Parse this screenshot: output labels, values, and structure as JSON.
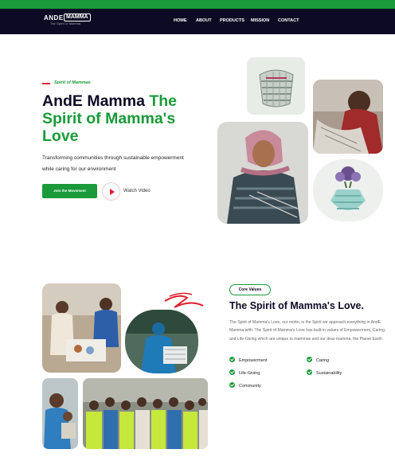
{
  "brand": {
    "logo_left": "ANDE",
    "logo_right": "MAMMA",
    "logo_tag": "The Spirit of Mamma"
  },
  "nav": {
    "items": [
      {
        "label": "HOME"
      },
      {
        "label": "ABOUT"
      },
      {
        "label": "PRODUCTS"
      },
      {
        "label": "MISSION"
      },
      {
        "label": "CONTACT"
      }
    ]
  },
  "hero": {
    "kicker": "Spirit of Mammas",
    "title_dark": "AndE Mamma ",
    "title_green": "The Spirit of Mamma's Love",
    "subtitle": "Transforming communities through sustainable empowerment while caring for our environment",
    "join_button": "Join the Movement",
    "watch_label": "Watch Video"
  },
  "values": {
    "badge": "Core Values",
    "title": "The Spirit of Mamma's Love.",
    "text": "The Spirit of Mamma's Love, our motto, is the Spirit we approach everything in AndE Mamma with. The Spirit of Mamma's Love has built-in values of Empowerment, Caring, and Life-Giving which are unique to mammas and our dear mamma, the Planet Earth.",
    "features": [
      "Empowerment",
      "Caring",
      "Life-Giving",
      "Sustainability",
      "Community"
    ]
  },
  "colors": {
    "accent": "#1a9a3a",
    "navy": "#0d0a24",
    "red": "#e01e2a"
  }
}
